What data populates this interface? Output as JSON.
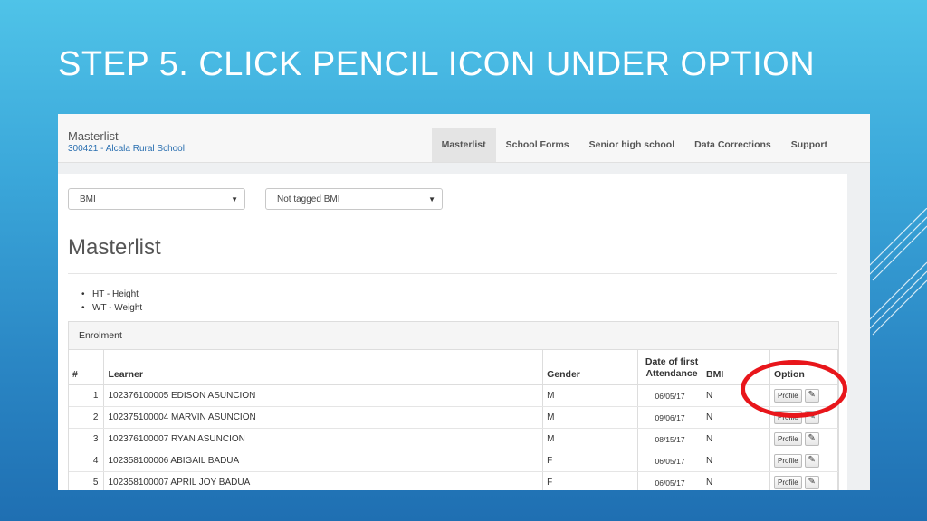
{
  "slide": {
    "title": "STEP 5. CLICK PENCIL ICON UNDER OPTION"
  },
  "app": {
    "brand_title": "Masterlist",
    "brand_subtitle": "300421 - Alcala Rural School"
  },
  "nav": [
    "Masterlist",
    "School Forms",
    "Senior high school",
    "Data Corrections",
    "Support"
  ],
  "filters": {
    "first": "BMI",
    "second": "Not tagged BMI"
  },
  "page": {
    "heading": "Masterlist",
    "legend": [
      "HT - Height",
      "WT - Weight"
    ]
  },
  "table": {
    "panel_title": "Enrolment",
    "headers": {
      "num": "#",
      "learner": "Learner",
      "gender": "Gender",
      "date_line1": "Date of first",
      "date_line2": "Attendance",
      "bmi": "BMI",
      "option": "Option"
    },
    "profile_label": "Profile",
    "rows": [
      {
        "num": "1",
        "learner": "102376100005 EDISON ASUNCION",
        "gender": "M",
        "date": "06/05/17",
        "bmi": "N"
      },
      {
        "num": "2",
        "learner": "102375100004 MARVIN ASUNCION",
        "gender": "M",
        "date": "09/06/17",
        "bmi": "N"
      },
      {
        "num": "3",
        "learner": "102376100007 RYAN ASUNCION",
        "gender": "M",
        "date": "08/15/17",
        "bmi": "N"
      },
      {
        "num": "4",
        "learner": "102358100006 ABIGAIL BADUA",
        "gender": "F",
        "date": "06/05/17",
        "bmi": "N"
      },
      {
        "num": "5",
        "learner": "102358100007 APRIL JOY BADUA",
        "gender": "F",
        "date": "06/05/17",
        "bmi": "N"
      }
    ]
  },
  "icons": {
    "pencil": "pencil-icon",
    "caret": "caret-down-icon"
  },
  "colors": {
    "highlight": "#e8161b",
    "link": "#2a6fb0"
  }
}
